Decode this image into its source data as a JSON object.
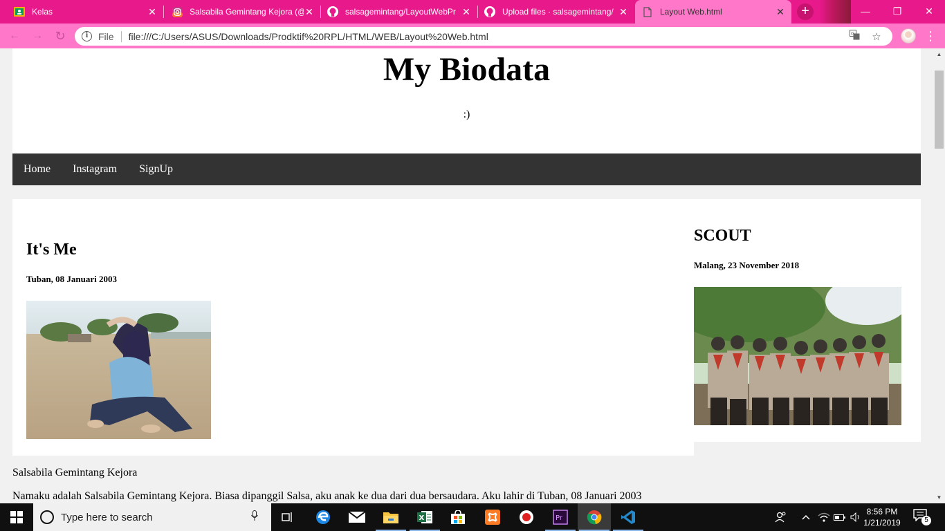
{
  "browser": {
    "tabs": [
      {
        "title": "Kelas",
        "icon": "google-classroom-icon"
      },
      {
        "title": "Salsabila Gemintang Kejora (@",
        "icon": "instagram-icon"
      },
      {
        "title": "salsagemintang/LayoutWebPr",
        "icon": "github-icon"
      },
      {
        "title": "Upload files · salsagemintang/",
        "icon": "github-icon"
      },
      {
        "title": "Layout Web.html",
        "icon": "file-icon",
        "active": true
      }
    ],
    "address": {
      "chip": "File",
      "url": "file:///C:/Users/ASUS/Downloads/Prodktif%20RPL/HTML/WEB/Layout%20Web.html"
    },
    "colors": {
      "tabstrip": "#e8198b",
      "toolbar": "#ff77c8"
    }
  },
  "page": {
    "header": {
      "title": "My Biodata",
      "subtitle": ":)"
    },
    "nav": [
      "Home",
      "Instagram",
      "SignUp"
    ],
    "left": {
      "heading": "It's Me",
      "date": "Tuban, 08 Januari 2003"
    },
    "right": {
      "heading": "SCOUT",
      "date": "Malang, 23 November 2018"
    },
    "bio": [
      "Salsabila Gemintang Kejora",
      "Namaku adalah Salsabila Gemintang Kejora. Biasa dipanggil Salsa, aku anak ke dua dari dua bersaudara. Aku lahir di Tuban, 08 Januari 2003"
    ]
  },
  "taskbar": {
    "search_placeholder": "Type here to search",
    "apps": [
      "task-view-icon",
      "edge-icon",
      "mail-icon",
      "file-explorer-icon",
      "excel-icon",
      "store-icon",
      "xampp-icon",
      "recorder-icon",
      "premiere-icon",
      "chrome-icon",
      "vscode-icon"
    ],
    "time": "8:56 PM",
    "date": "1/21/2019",
    "notifications": "5"
  }
}
